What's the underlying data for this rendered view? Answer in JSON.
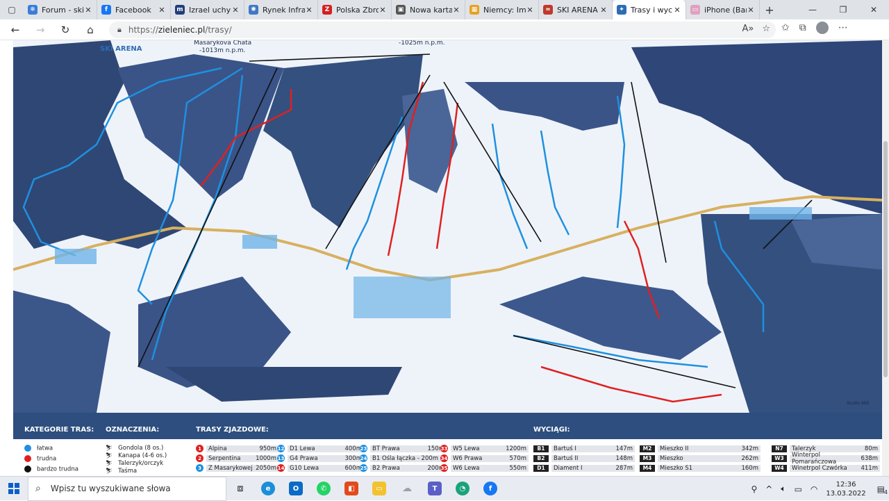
{
  "tabs": [
    {
      "title": "Forum - ski",
      "color": "#3b7dd8",
      "glyph": "❄"
    },
    {
      "title": "Facebook",
      "color": "#1877f2",
      "glyph": "f"
    },
    {
      "title": "Izrael uchyli",
      "color": "#1f3f7a",
      "glyph": "m"
    },
    {
      "title": "Rynek Infra",
      "color": "#3f78c4",
      "glyph": "✺"
    },
    {
      "title": "Polska Zbro",
      "color": "#d42020",
      "glyph": "Z"
    },
    {
      "title": "Nowa karta",
      "color": "#555555",
      "glyph": "▣"
    },
    {
      "title": "Niemcy: Im",
      "color": "#e8a020",
      "glyph": "▦"
    },
    {
      "title": "SKI ARENA",
      "color": "#c0392b",
      "glyph": "≈"
    },
    {
      "title": "Trasy i wyci",
      "color": "#2d6db5",
      "glyph": "✦"
    },
    {
      "title": "iPhone (Bar",
      "color": "#e0a0c0",
      "glyph": "▭"
    }
  ],
  "active_tab_index": 8,
  "address": {
    "protocol": "https://",
    "host": "zieleniec.pl",
    "path": "/trasy/"
  },
  "map": {
    "brand": "SKI ARENA",
    "peak_left": "Masarykova Chata",
    "peak_left_alt": "-1013m n.p.m.",
    "peak_right_alt": "-1025m n.p.m.",
    "credit": "Studio 660"
  },
  "legend": {
    "categories_title": "KATEGORIE TRAS:",
    "markings_title": "OZNACZENIA:",
    "trails_title": "TRASY ZJAZDOWE:",
    "lifts_title": "WYCIĄGI:",
    "categories": [
      {
        "label": "łatwa",
        "color": "#1e90e0"
      },
      {
        "label": "trudna",
        "color": "#e02020"
      },
      {
        "label": "bardzo trudna",
        "color": "#111111"
      }
    ],
    "markings": [
      "Gondola  (8 os.)",
      "Kanapa (4-6 os.)",
      "Talerzyk/orczyk",
      "Taśma"
    ],
    "trails_col1": [
      {
        "num": "1",
        "color": "#e02020",
        "name": "Alpina",
        "len": "950m"
      },
      {
        "num": "2",
        "color": "#e02020",
        "name": "Serpentina",
        "len": "1000m"
      },
      {
        "num": "3",
        "color": "#1e90e0",
        "name": "Z Masarykowej",
        "len": "2050m"
      }
    ],
    "trails_col2": [
      {
        "num": "12",
        "color": "#1e90e0",
        "name": "D1 Lewa",
        "len": "400m"
      },
      {
        "num": "13",
        "color": "#1e90e0",
        "name": "G4 Prawa",
        "len": "300m"
      },
      {
        "num": "14",
        "color": "#e02020",
        "name": "G10 Lewa",
        "len": "600m"
      }
    ],
    "trails_col3": [
      {
        "num": "23",
        "color": "#1e90e0",
        "name": "BT Prawa",
        "len": "150m"
      },
      {
        "num": "24",
        "color": "#1e90e0",
        "name": "B1 Ośla łączka - 200m",
        "len": ""
      },
      {
        "num": "25",
        "color": "#1e90e0",
        "name": "B2 Prawa",
        "len": "200m"
      }
    ],
    "trails_col4": [
      {
        "num": "33",
        "color": "#e02020",
        "name": "W5 Lewa",
        "len": "1200m"
      },
      {
        "num": "34",
        "color": "#e02020",
        "name": "W6 Prawa",
        "len": "570m"
      },
      {
        "num": "35",
        "color": "#e02020",
        "name": "W6 Lewa",
        "len": "550m"
      }
    ],
    "lifts_col1": [
      {
        "code": "B1",
        "name": "Bartuś I",
        "len": "147m"
      },
      {
        "code": "B2",
        "name": "Bartuś II",
        "len": "148m"
      },
      {
        "code": "D1",
        "name": "Diament I",
        "len": "287m"
      }
    ],
    "lifts_col2": [
      {
        "code": "M2",
        "name": "Mieszko II",
        "len": "342m"
      },
      {
        "code": "M3",
        "name": "Mieszko",
        "len": "262m"
      },
      {
        "code": "M4",
        "name": "Mieszko S1",
        "len": "160m"
      }
    ],
    "lifts_col3": [
      {
        "code": "N7",
        "name": "Talerzyk",
        "len": "80m"
      },
      {
        "code": "W3",
        "name": "Winterpol Pomarańczowa",
        "len": "638m"
      },
      {
        "code": "W4",
        "name": "Winetrpol Czwórka",
        "len": "411m"
      }
    ]
  },
  "taskbar": {
    "search_placeholder": "Wpisz tu wyszukiwane słowa",
    "time": "12:36",
    "date": "13.03.2022",
    "notifications": "4"
  }
}
